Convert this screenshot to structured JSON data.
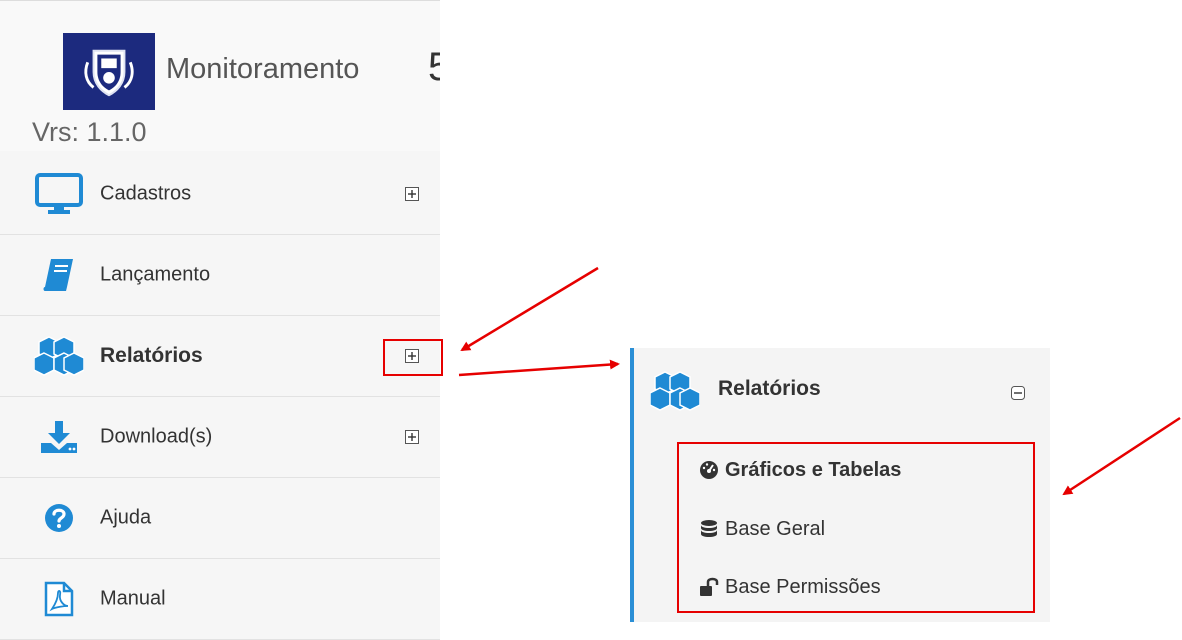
{
  "brand": {
    "title": "Monitoramento",
    "title_cut": "5",
    "version": "Vrs: 1.1.0"
  },
  "sidebar": {
    "items": [
      {
        "label": "Cadastros",
        "icon": "monitor-icon",
        "expandable": true
      },
      {
        "label": "Lançamento",
        "icon": "book-icon",
        "expandable": false
      },
      {
        "label": "Relatórios",
        "icon": "cubes-icon",
        "expandable": true,
        "highlighted": true
      },
      {
        "label": "Download(s)",
        "icon": "download-icon",
        "expandable": true
      },
      {
        "label": "Ajuda",
        "icon": "question-circle-icon",
        "expandable": false
      },
      {
        "label": "Manual",
        "icon": "pdf-file-icon",
        "expandable": false
      }
    ]
  },
  "expanded_panel": {
    "header": {
      "label": "Relatórios",
      "icon": "cubes-icon"
    },
    "submenu": [
      {
        "label": "Gráficos e Tabelas",
        "icon": "dashboard-icon",
        "bold": true
      },
      {
        "label": "Base Geral",
        "icon": "database-icon",
        "bold": false
      },
      {
        "label": "Base Permissões",
        "icon": "unlock-icon",
        "bold": false
      }
    ]
  },
  "colors": {
    "accent_blue": "#1f8ad4",
    "logo_navy": "#1c2a7e",
    "annotation_red": "#e60000",
    "panel_border": "#2b8fd6"
  }
}
